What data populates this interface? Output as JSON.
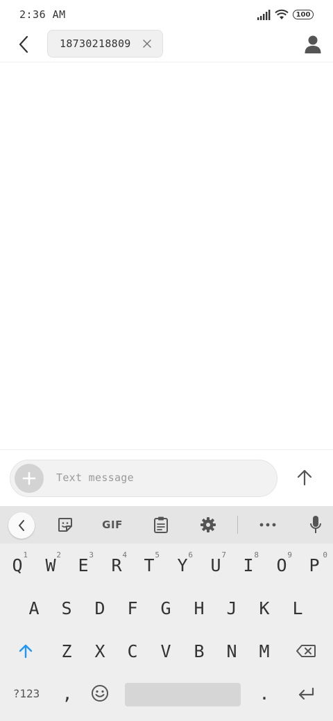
{
  "status_bar": {
    "time": "2:36 AM",
    "battery": "100"
  },
  "header": {
    "recipient": "18730218809"
  },
  "compose": {
    "placeholder": "Text message"
  },
  "keyboard": {
    "toolbar": {
      "gif_label": "GIF"
    },
    "row1": [
      {
        "letter": "Q",
        "num": "1"
      },
      {
        "letter": "W",
        "num": "2"
      },
      {
        "letter": "E",
        "num": "3"
      },
      {
        "letter": "R",
        "num": "4"
      },
      {
        "letter": "T",
        "num": "5"
      },
      {
        "letter": "Y",
        "num": "6"
      },
      {
        "letter": "U",
        "num": "7"
      },
      {
        "letter": "I",
        "num": "8"
      },
      {
        "letter": "O",
        "num": "9"
      },
      {
        "letter": "P",
        "num": "0"
      }
    ],
    "row2": [
      "A",
      "S",
      "D",
      "F",
      "G",
      "H",
      "J",
      "K",
      "L"
    ],
    "row3": [
      "Z",
      "X",
      "C",
      "V",
      "B",
      "N",
      "M"
    ],
    "symbols_label": "?123",
    "comma": ",",
    "period": "."
  },
  "colors": {
    "accent": "#2196f3",
    "keyboard_bg": "#eeeeee",
    "toolbar_bg": "#e5e5e5"
  }
}
